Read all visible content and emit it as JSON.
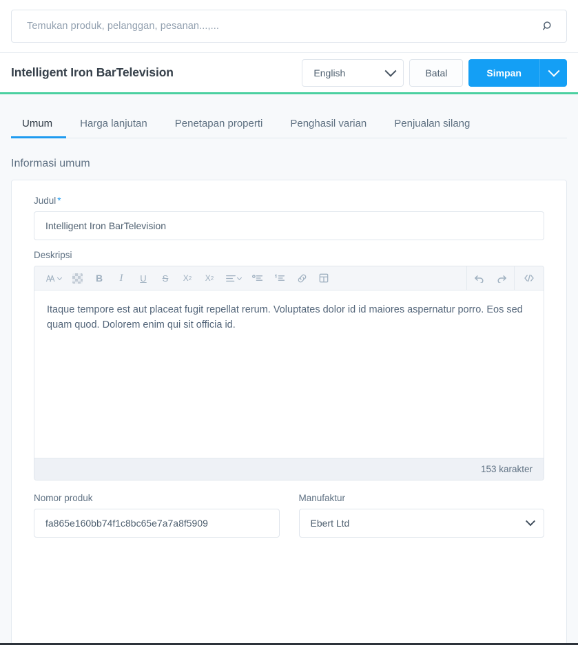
{
  "search": {
    "placeholder": "Temukan produk, pelanggan, pesanan...,...",
    "icon": "search-icon"
  },
  "header": {
    "title": "Intelligent Iron BarTelevision",
    "language_select": {
      "value": "English"
    },
    "cancel_label": "Batal",
    "save_label": "Simpan",
    "accent_color": "#4bd0a0",
    "primary_color": "#149ff5"
  },
  "tabs": [
    {
      "label": "Umum",
      "active": true
    },
    {
      "label": "Harga lanjutan",
      "active": false
    },
    {
      "label": "Penetapan properti",
      "active": false
    },
    {
      "label": "Penghasil varian",
      "active": false
    },
    {
      "label": "Penjualan silang",
      "active": false
    }
  ],
  "section": {
    "title": "Informasi umum"
  },
  "form": {
    "title_field": {
      "label": "Judul",
      "required_marker": "*",
      "value": "Intelligent Iron BarTelevision"
    },
    "description_field": {
      "label": "Deskripsi",
      "value": "Itaque tempore est aut placeat fugit repellat rerum. Voluptates dolor id id maiores aspernatur porro. Eos sed quam quod. Dolorem enim qui sit officia id.",
      "char_count": "153 karakter"
    },
    "product_number_field": {
      "label": "Nomor produk",
      "value": "fa865e160bb74f1c8bc65e7a7a8f5909"
    },
    "manufacturer_field": {
      "label": "Manufaktur",
      "value": "Ebert Ltd"
    }
  },
  "editor_toolbar": {
    "left_icons": [
      "font-style-icon",
      "text-color-swatch-icon",
      "bold-icon",
      "italic-icon",
      "underline-icon",
      "strikethrough-icon",
      "superscript-icon",
      "subscript-icon",
      "align-icon",
      "bullet-list-icon",
      "numbered-list-icon",
      "link-icon",
      "table-icon"
    ],
    "right_icons": [
      "undo-icon",
      "redo-icon",
      "code-view-icon"
    ],
    "labels": {
      "font_style": "A",
      "bold": "B",
      "italic": "I",
      "underline": "U",
      "strikethrough": "S",
      "superscript": "X",
      "superscript_sup": "2",
      "subscript": "X",
      "subscript_sub": "2",
      "code": "</>"
    }
  }
}
